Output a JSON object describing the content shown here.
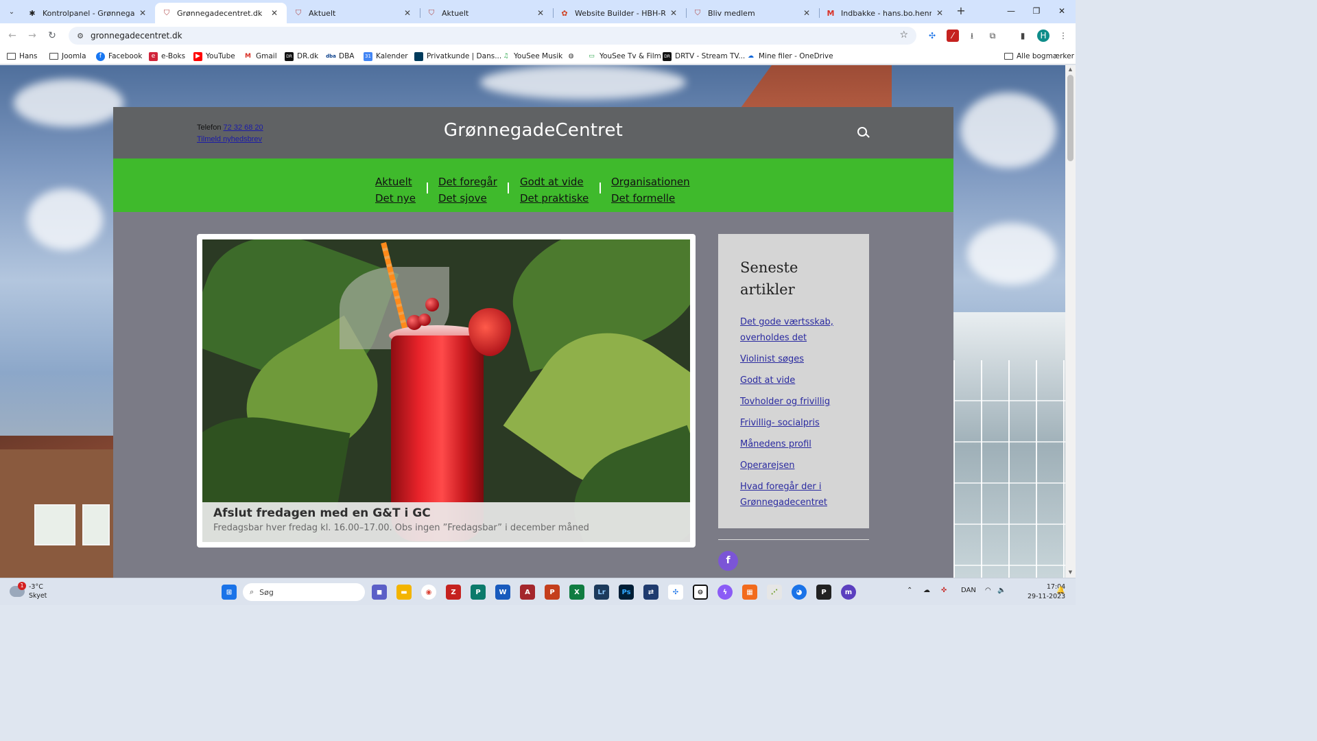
{
  "browser": {
    "tabs": [
      {
        "title": "Kontrolpanel - Grønnegadecen",
        "icon": "joomla-icon"
      },
      {
        "title": "Grønnegadecentret.dk",
        "icon": "shield-icon",
        "active": true
      },
      {
        "title": "Aktuelt",
        "icon": "shield-icon"
      },
      {
        "title": "Aktuelt",
        "icon": "shield-icon"
      },
      {
        "title": "Website Builder - HBH-Rådgiv",
        "icon": "builder-icon"
      },
      {
        "title": "Bliv medlem",
        "icon": "shield-icon"
      },
      {
        "title": "Indbakke - hans.bo.henriksen",
        "icon": "gmail-icon"
      }
    ],
    "url": "gronnegadecentret.dk",
    "bookmarks": [
      {
        "label": "Hans",
        "icon": "folder-icon"
      },
      {
        "label": "Joomla",
        "icon": "folder-icon"
      },
      {
        "label": "Facebook",
        "icon": "facebook-icon"
      },
      {
        "label": "e-Boks",
        "icon": "eboks-icon"
      },
      {
        "label": "YouTube",
        "icon": "youtube-icon"
      },
      {
        "label": "Gmail",
        "icon": "gmail-icon"
      },
      {
        "label": "DR.dk",
        "icon": "dr-icon"
      },
      {
        "label": "DBA",
        "icon": "dba-icon"
      },
      {
        "label": "Kalender",
        "icon": "calendar-icon"
      },
      {
        "label": "Privatkunde | Dans...",
        "icon": "bank-icon"
      },
      {
        "label": "YouSee Musik",
        "icon": "music-icon"
      },
      {
        "label": "",
        "icon": "globe-icon"
      },
      {
        "label": "YouSee Tv & Film",
        "icon": "tv-icon"
      },
      {
        "label": "DRTV - Stream TV...",
        "icon": "drtv-icon"
      },
      {
        "label": "Mine filer - OneDrive",
        "icon": "onedrive-icon"
      }
    ],
    "all_bookmarks": "Alle bogmærker",
    "profile_initial": "H"
  },
  "site": {
    "phone_label": "Telefon",
    "phone_number": "72 32 68 20",
    "newsletter": "Tilmeld nyhedsbrev",
    "title": "GrønnegadeCentret",
    "nav": [
      {
        "top": "Aktuelt",
        "bottom": "Det nye"
      },
      {
        "top": "Det foregår",
        "bottom": "Det sjove"
      },
      {
        "top": "Godt at vide",
        "bottom": "Det praktiske"
      },
      {
        "top": "Organisationen",
        "bottom": "Det formelle"
      }
    ],
    "featured": {
      "title": "Afslut fredagen med en G&T i GC",
      "text": "Fredagsbar hver fredag kl. 16.00–17.00. Obs ingen ”Fredagsbar”  i december måned"
    },
    "sidebar": {
      "title_line1": "Seneste",
      "title_line2": "artikler",
      "links": [
        "Det gode værtsskab, overholdes det",
        "Violinist søges",
        "Godt at vide",
        "Tovholder og frivillig",
        "Frivillig- socialpris",
        "Månedens profil",
        "Operarejsen",
        "Hvad foregår der i Grønnegadecentret"
      ]
    },
    "facebook_glyph": "f",
    "colors": {
      "header": "#606264",
      "nav": "#3fba2c",
      "body": "#7b7b86",
      "sidebar": "#d5d5d5",
      "link": "#2a2aa0",
      "facebook": "#7b55d6"
    }
  },
  "taskbar": {
    "weather_badge": "1",
    "temperature": "-3°C",
    "condition": "Skyet",
    "search_placeholder": "Søg",
    "language": "DAN",
    "time": "17:04",
    "date": "29-11-2023"
  }
}
